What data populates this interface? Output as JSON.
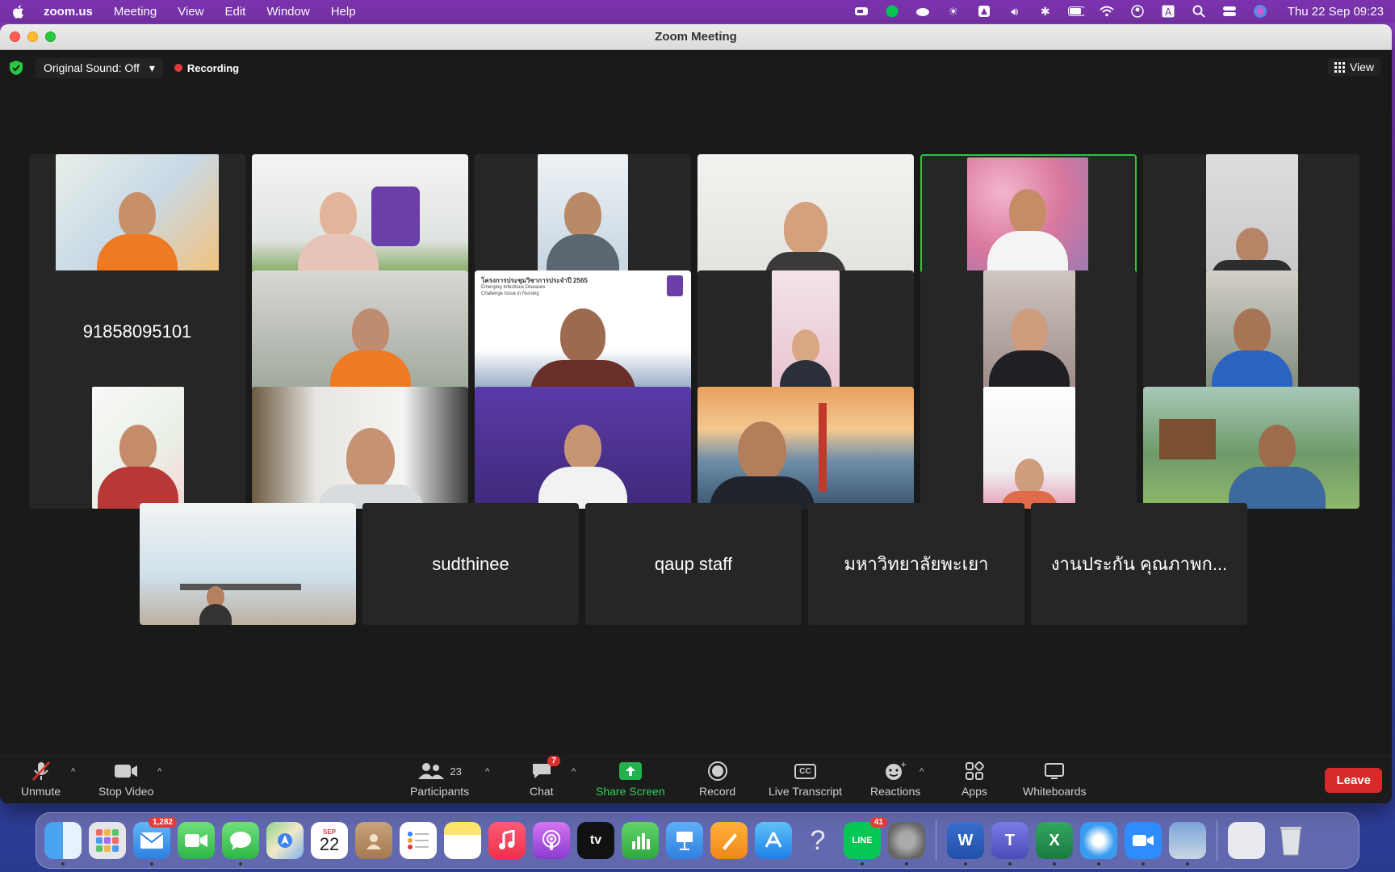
{
  "menubar": {
    "app_name": "zoom.us",
    "menus": [
      "Meeting",
      "View",
      "Edit",
      "Window",
      "Help"
    ],
    "clock": "Thu 22 Sep  09:23"
  },
  "window": {
    "title": "Zoom Meeting"
  },
  "topbar": {
    "original_sound": "Original Sound: Off",
    "recording": "Recording",
    "view": "View"
  },
  "tiles": {
    "name_only_1": "91858095101",
    "name_only_2": "sudthinee",
    "name_only_3": "qaup staff",
    "name_only_4": "มหาวิทยาลัยพะเยา",
    "name_only_5": "งานประกัน คุณภาพก...",
    "slide_title": "โครงการประชุมวิชาการประจำปี 2565",
    "slide_sub1": "Emerging Infectious Diseases",
    "slide_sub2": "Challenge Issue in Nursing"
  },
  "toolbar": {
    "unmute": "Unmute",
    "stop_video": "Stop Video",
    "participants": "Participants",
    "participants_count": "23",
    "chat": "Chat",
    "chat_badge": "7",
    "share_screen": "Share Screen",
    "record": "Record",
    "live_transcript": "Live Transcript",
    "cc": "CC",
    "reactions": "Reactions",
    "apps": "Apps",
    "whiteboards": "Whiteboards",
    "leave": "Leave"
  },
  "dock": {
    "mail_badge": "1,282",
    "calendar_month": "SEP",
    "calendar_day": "22",
    "line_badge": "41",
    "line_label": "LINE",
    "tv_label": "tv"
  },
  "colors": {
    "accent_green": "#27c93f",
    "leave_red": "#d72a2a",
    "record_red": "#e23b3b"
  }
}
